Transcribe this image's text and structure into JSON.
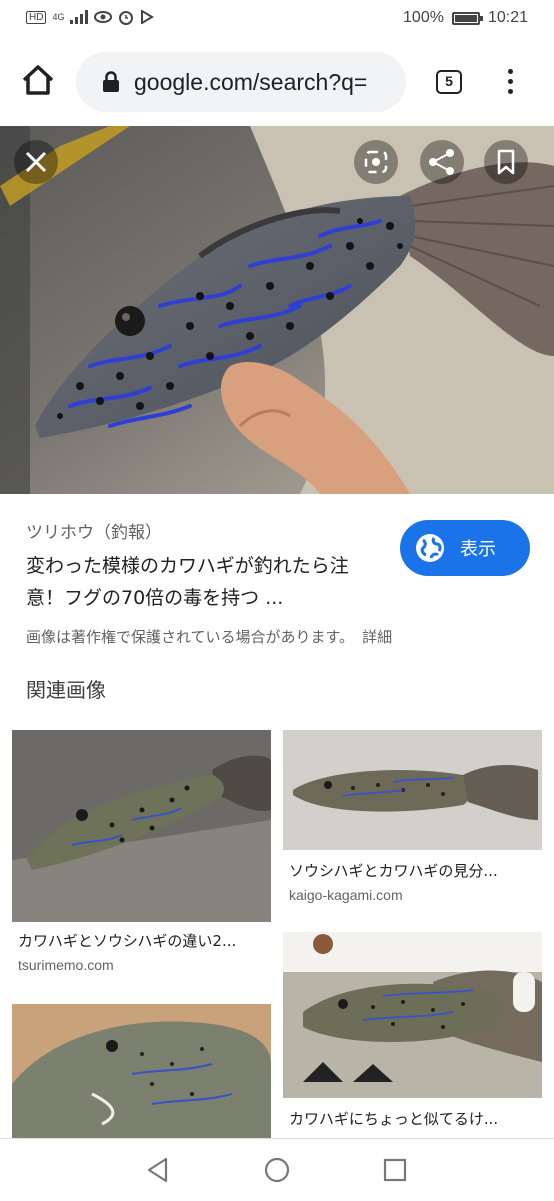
{
  "status_bar": {
    "network_badge": "HD",
    "network_type": "4G",
    "battery_percent": "100%",
    "time": "10:21",
    "battery_level": 1.0
  },
  "browser": {
    "url": "google.com/search?q=",
    "tab_count": "5"
  },
  "viewer": {
    "source": "ツリホウ（釣報）",
    "title": "変わった模様のカワハギが釣れたら注意！フグの70倍の毒を持つ ...",
    "view_button": "表示",
    "copyright_notice": "画像は著作権で保護されている場合があります。",
    "details_link": "詳細",
    "related_heading": "関連画像"
  },
  "related_images": [
    {
      "caption": "カワハギとソウシハギの違い2...",
      "domain": "tsurimemo.com"
    },
    {
      "caption": "ソウシハギとカワハギの見分...",
      "domain": "kaigo-kagami.com"
    },
    {
      "caption": "",
      "domain": ""
    },
    {
      "caption": "カワハギにちょっと似てるけ...",
      "domain": ""
    }
  ],
  "colors": {
    "accent": "#1a73e8",
    "fish_body": "#5b5e63",
    "fish_lines": "#2f3fd6"
  },
  "icons": {
    "home": "home-icon",
    "lock": "lock-icon",
    "menu": "more-vert-icon",
    "close": "close-icon",
    "lens": "lens-search-icon",
    "share": "share-icon",
    "bookmark": "bookmark-icon",
    "globe": "globe-icon",
    "back": "back-triangle-icon",
    "home_nav": "home-circle-icon",
    "recents": "recents-square-icon"
  }
}
